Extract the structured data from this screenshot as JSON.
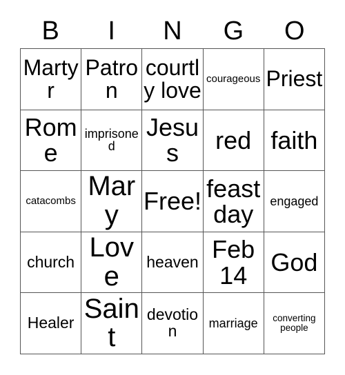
{
  "card": {
    "title": "BINGO",
    "headers": [
      "B",
      "I",
      "N",
      "G",
      "O"
    ],
    "colors": {
      "text": "#000000",
      "background": "#ffffff",
      "border": "#555555"
    },
    "grid": {
      "columns": 5,
      "rows": 5,
      "cells": [
        [
          {
            "text": "Martyr",
            "size": "l"
          },
          {
            "text": "Patron",
            "size": "l"
          },
          {
            "text": "courtly love",
            "size": "l"
          },
          {
            "text": "courageous",
            "size": "xs"
          },
          {
            "text": "Priest",
            "size": "l"
          }
        ],
        [
          {
            "text": "Rome",
            "size": "xl"
          },
          {
            "text": "imprisoned",
            "size": "s"
          },
          {
            "text": "Jesus",
            "size": "xl"
          },
          {
            "text": "red",
            "size": "xl"
          },
          {
            "text": "faith",
            "size": "xl"
          }
        ],
        [
          {
            "text": "catacombs",
            "size": "xs"
          },
          {
            "text": "Mary",
            "size": "xxl"
          },
          {
            "text": "Free!",
            "size": "xl"
          },
          {
            "text": "feast day",
            "size": "xl"
          },
          {
            "text": "engaged",
            "size": "s"
          }
        ],
        [
          {
            "text": "church",
            "size": "m"
          },
          {
            "text": "Love",
            "size": "xxl"
          },
          {
            "text": "heaven",
            "size": "m"
          },
          {
            "text": "Feb 14",
            "size": "xl"
          },
          {
            "text": "God",
            "size": "xl"
          }
        ],
        [
          {
            "text": "Healer",
            "size": "m"
          },
          {
            "text": "Saint",
            "size": "xxl"
          },
          {
            "text": "devotion",
            "size": "m"
          },
          {
            "text": "marriage",
            "size": "s"
          },
          {
            "text": "converting people",
            "size": "xxs"
          }
        ]
      ]
    }
  }
}
